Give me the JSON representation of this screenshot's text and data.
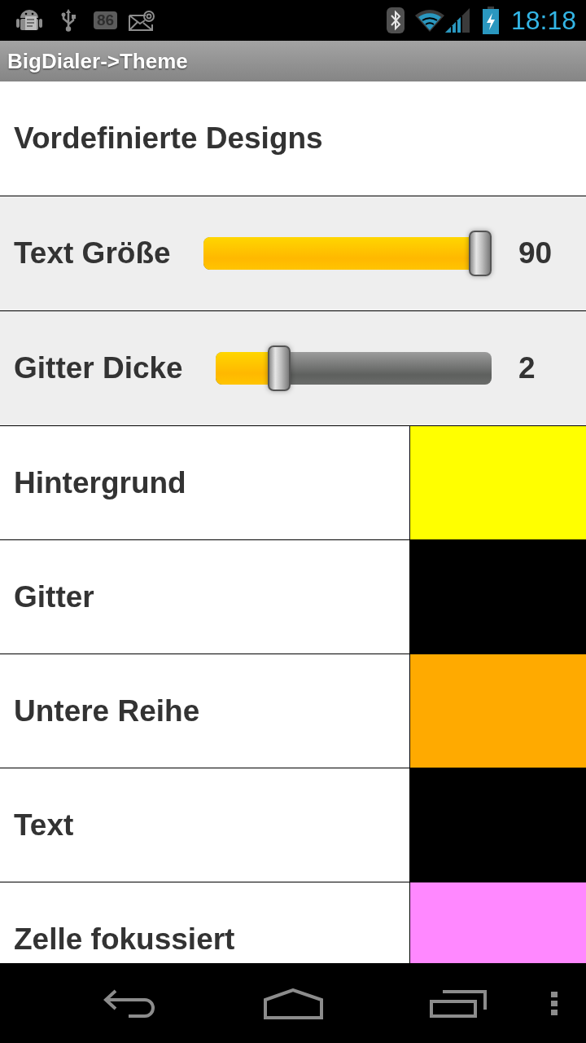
{
  "status_bar": {
    "battery_notice": "86",
    "time": "18:18"
  },
  "title_bar": {
    "title": "BigDialer->Theme"
  },
  "presets": {
    "label": "Vordefinierte Designs"
  },
  "sliders": [
    {
      "label": "Text Größe",
      "level": 0.96,
      "reading": "90"
    },
    {
      "label": "Gitter Dicke",
      "level": 0.23,
      "reading": "2"
    }
  ],
  "colors": [
    {
      "label": "Hintergrund",
      "color": "#ffff00"
    },
    {
      "label": "Gitter",
      "color": "#000000"
    },
    {
      "label": "Untere Reihe",
      "color": "#ffaa00"
    },
    {
      "label": "Text",
      "color": "#000000"
    },
    {
      "label": "Zelle fokussiert",
      "color": "#ff88ff"
    }
  ]
}
